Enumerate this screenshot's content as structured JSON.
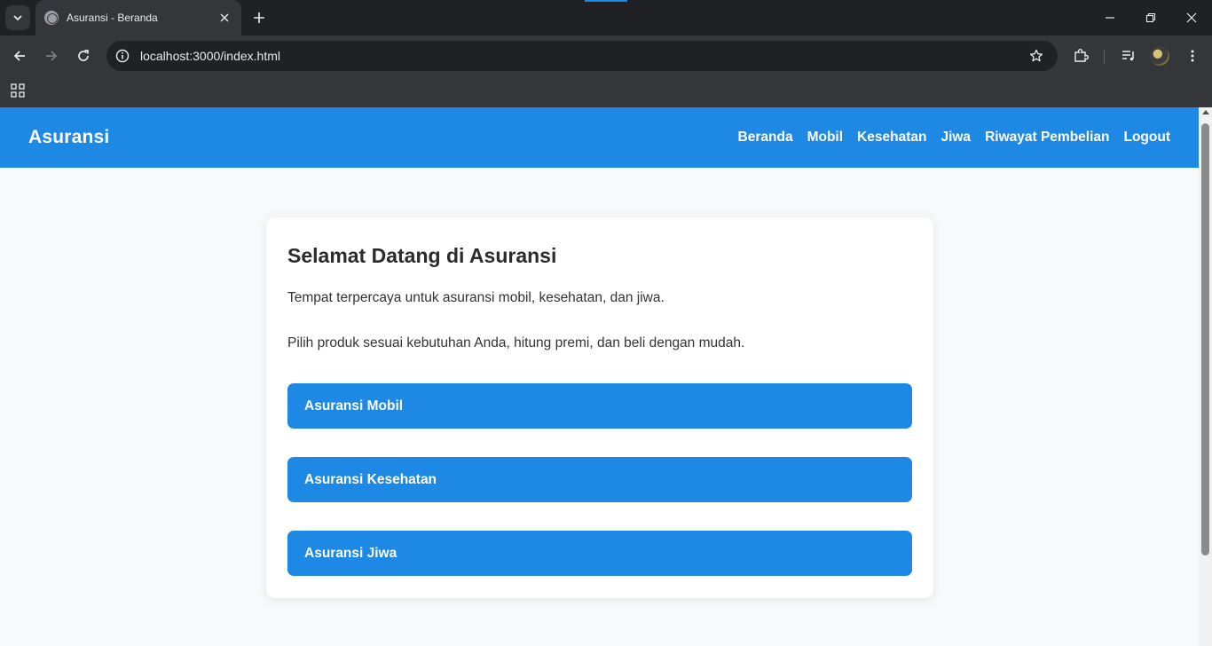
{
  "browser": {
    "tab_title": "Asuransi - Beranda",
    "url": "localhost:3000/index.html",
    "accent_color": "#1e88e5"
  },
  "navbar": {
    "brand": "Asuransi",
    "links": [
      "Beranda",
      "Mobil",
      "Kesehatan",
      "Jiwa",
      "Riwayat Pembelian",
      "Logout"
    ],
    "background": "#1e88e5"
  },
  "main": {
    "title": "Selamat Datang di Asuransi",
    "paragraphs": [
      "Tempat terpercaya untuk asuransi mobil, kesehatan, dan jiwa.",
      "Pilih produk sesuai kebutuhan Anda, hitung premi, dan beli dengan mudah."
    ],
    "buttons": [
      "Asuransi Mobil",
      "Asuransi Kesehatan",
      "Asuransi Jiwa"
    ]
  }
}
